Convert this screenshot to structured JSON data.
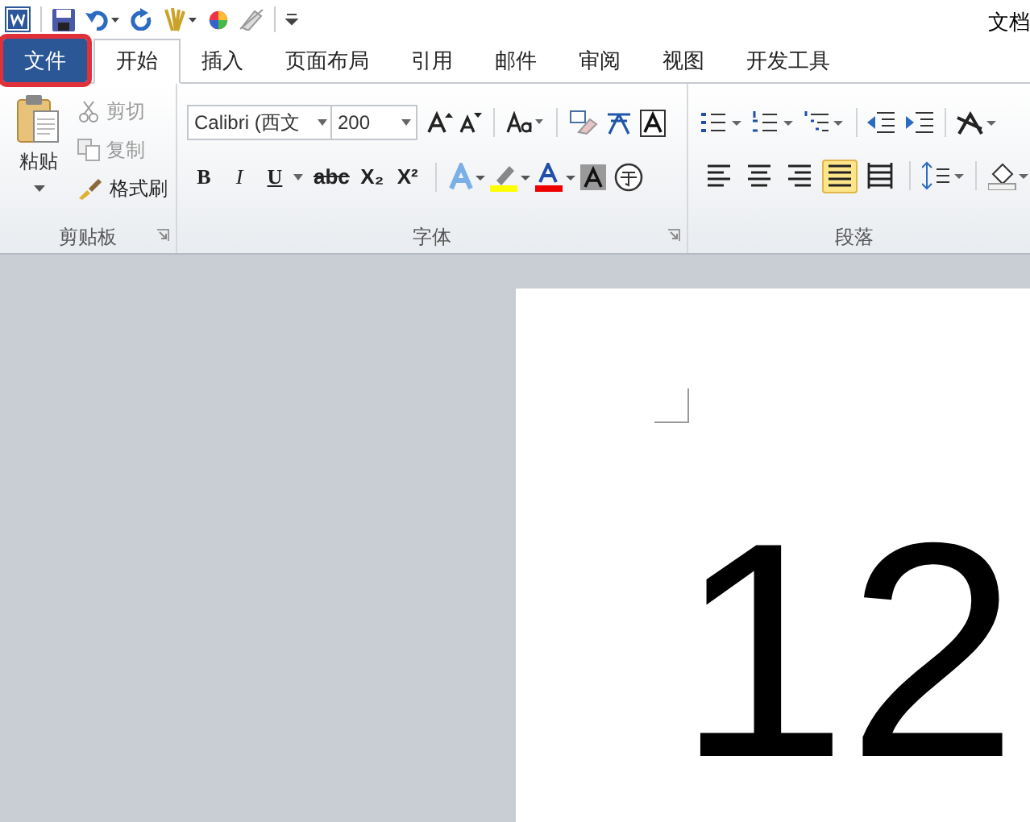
{
  "window": {
    "title": "文档"
  },
  "tabs": [
    {
      "label": "文件",
      "kind": "file",
      "selected": false,
      "highlighted": true
    },
    {
      "label": "开始",
      "kind": "tab",
      "selected": true,
      "highlighted": false
    },
    {
      "label": "插入",
      "kind": "tab",
      "selected": false,
      "highlighted": false
    },
    {
      "label": "页面布局",
      "kind": "tab",
      "selected": false,
      "highlighted": false
    },
    {
      "label": "引用",
      "kind": "tab",
      "selected": false,
      "highlighted": false
    },
    {
      "label": "邮件",
      "kind": "tab",
      "selected": false,
      "highlighted": false
    },
    {
      "label": "审阅",
      "kind": "tab",
      "selected": false,
      "highlighted": false
    },
    {
      "label": "视图",
      "kind": "tab",
      "selected": false,
      "highlighted": false
    },
    {
      "label": "开发工具",
      "kind": "tab",
      "selected": false,
      "highlighted": false
    }
  ],
  "clipboard": {
    "label": "剪贴板",
    "paste": "粘贴",
    "items": [
      {
        "label": "剪切",
        "disabled": true
      },
      {
        "label": "复制",
        "disabled": true
      },
      {
        "label": "格式刷",
        "disabled": false
      }
    ]
  },
  "font": {
    "label": "字体",
    "font_name": "Calibri (西文",
    "font_size": "200",
    "buttons": [
      "B",
      "I",
      "U",
      "abc",
      "X₂",
      "X²"
    ]
  },
  "paragraph": {
    "label": "段落",
    "alignments": [
      {
        "selected": false
      },
      {
        "selected": false
      },
      {
        "selected": false
      },
      {
        "selected": true
      },
      {
        "selected": false
      }
    ]
  },
  "document": {
    "text": "12"
  }
}
